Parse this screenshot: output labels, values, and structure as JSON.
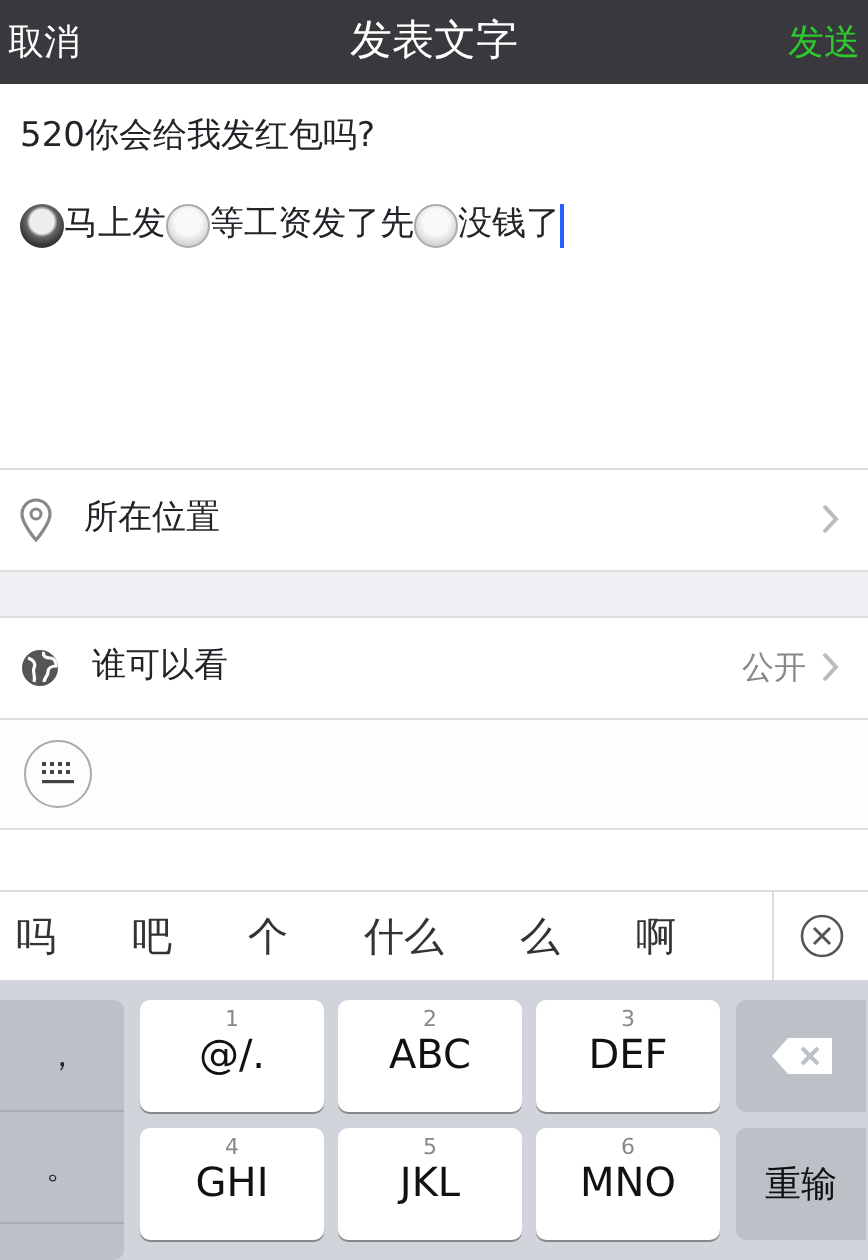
{
  "nav": {
    "cancel": "取消",
    "title": "发表文字",
    "send": "发送"
  },
  "post": {
    "question": "520你会给我发红包吗?",
    "options": [
      {
        "label": "马上发",
        "selected": true
      },
      {
        "label": "等工资发了先",
        "selected": false
      },
      {
        "label": "没钱了",
        "selected": false
      }
    ]
  },
  "location": {
    "label": "所在位置"
  },
  "visibility": {
    "label": "谁可以看",
    "value": "公开"
  },
  "candidates": [
    "吗",
    "吧",
    "个",
    "什么",
    "么",
    "啊"
  ],
  "keyboard": {
    "left_keys": [
      "，",
      "。"
    ],
    "keys": [
      {
        "digit": "1",
        "letters": "@/."
      },
      {
        "digit": "2",
        "letters": "ABC"
      },
      {
        "digit": "3",
        "letters": "DEF"
      },
      {
        "digit": "4",
        "letters": "GHI"
      },
      {
        "digit": "5",
        "letters": "JKL"
      },
      {
        "digit": "6",
        "letters": "MNO"
      }
    ],
    "reset": "重输"
  }
}
